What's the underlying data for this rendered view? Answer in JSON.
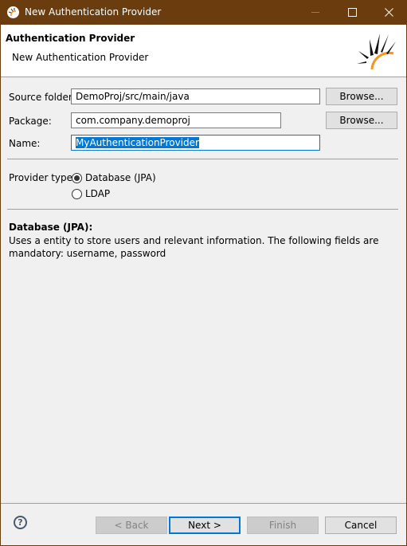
{
  "window": {
    "title": "New Authentication Provider",
    "controls": {
      "minimize": "minimize",
      "maximize": "maximize",
      "close": "×"
    }
  },
  "header": {
    "title": "Authentication Provider",
    "subtitle": "New Authentication Provider"
  },
  "form": {
    "source_folder": {
      "label": "Source folder:",
      "value": "DemoProj/src/main/java",
      "browse": "Browse..."
    },
    "package": {
      "label": "Package:",
      "value": "com.company.demoproj",
      "browse": "Browse..."
    },
    "name": {
      "label": "Name:",
      "value": "MyAuthenticationProvider"
    },
    "provider_type": {
      "label": "Provider type:",
      "options": [
        {
          "label": "Database (JPA)",
          "checked": true
        },
        {
          "label": "LDAP",
          "checked": false
        }
      ]
    }
  },
  "description": {
    "title": "Database (JPA):",
    "text": "Uses a entity to store users and relevant information. The following fields are mandatory: username, password"
  },
  "footer": {
    "help": "?",
    "back": "< Back",
    "next": "Next >",
    "finish": "Finish",
    "cancel": "Cancel"
  },
  "colors": {
    "titlebar": "#6b3c0e",
    "accent": "#0078d7",
    "logo_orange": "#f7941d"
  }
}
